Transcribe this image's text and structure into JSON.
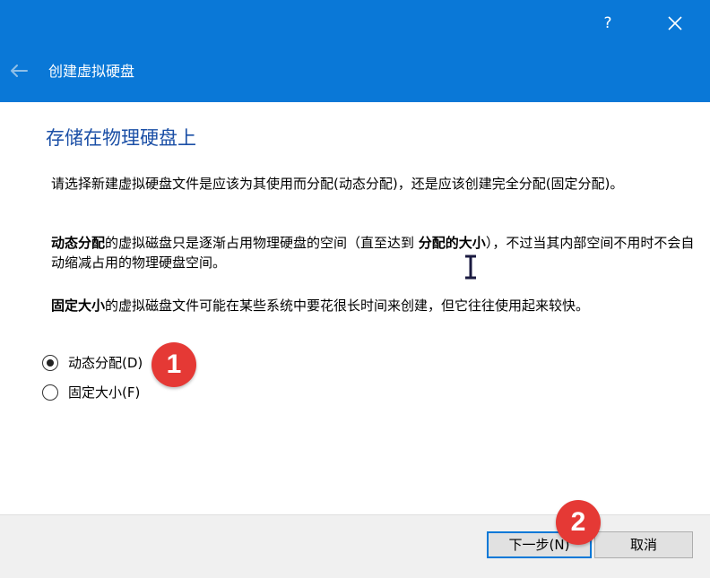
{
  "window": {
    "help_glyph": "?",
    "title": "创建虚拟硬盘",
    "accent_color": "#0a78d7"
  },
  "page": {
    "heading": "存储在物理硬盘上",
    "p1": "请选择新建虚拟硬盘文件是应该为其使用而分配(动态分配)，还是应该创建完全分配(固定分配)。",
    "p2_bold1": "动态分配",
    "p2_mid": "的虚拟磁盘只是逐渐占用物理硬盘的空间（直至达到 ",
    "p2_bold2": "分配的大小",
    "p2_end": "），不过当其内部空间不用时不会自动缩减占用的物理硬盘空间。",
    "p3_bold": "固定大小",
    "p3_rest": "的虚拟磁盘文件可能在某些系统中要花很长时间来创建，但它往往使用起来较快。"
  },
  "options": {
    "dynamic_label": "动态分配(D)",
    "fixed_label": "固定大小(F)",
    "selected": "dynamic"
  },
  "buttons": {
    "next": "下一步(N)",
    "cancel": "取消"
  },
  "badges": {
    "one": "1",
    "two": "2",
    "color": "#e53935"
  }
}
